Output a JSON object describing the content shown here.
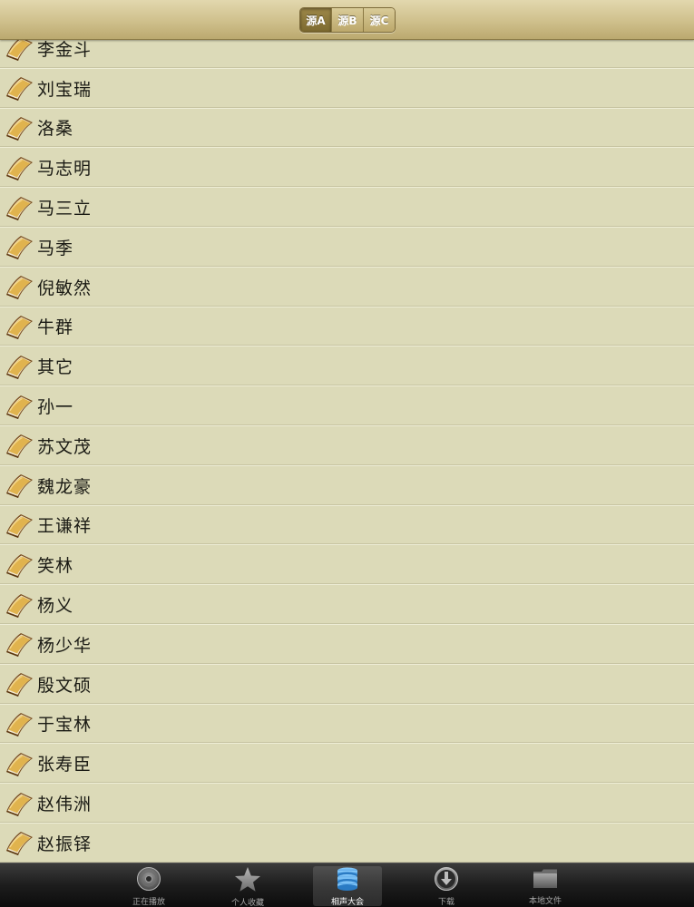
{
  "header": {
    "segments": [
      {
        "label": "源A",
        "selected": true
      },
      {
        "label": "源B",
        "selected": false
      },
      {
        "label": "源C",
        "selected": false
      }
    ]
  },
  "list": {
    "icon": "book-icon",
    "items": [
      "李金斗",
      "刘宝瑞",
      "洛桑",
      "马志明",
      "马三立",
      "马季",
      "倪敏然",
      "牛群",
      "其它",
      "孙一",
      "苏文茂",
      "魏龙豪",
      "王谦祥",
      "笑林",
      "杨义",
      "杨少华",
      "殷文硕",
      "于宝林",
      "张寿臣",
      "赵伟洲",
      "赵振铎"
    ]
  },
  "tabbar": {
    "items": [
      {
        "label": "正在播放",
        "icon": "disc-icon",
        "active": false
      },
      {
        "label": "个人收藏",
        "icon": "star-icon",
        "active": false
      },
      {
        "label": "相声大会",
        "icon": "database-icon",
        "active": true
      },
      {
        "label": "下载",
        "icon": "download-icon",
        "active": false
      },
      {
        "label": "本地文件",
        "icon": "folder-icon",
        "active": false
      }
    ]
  },
  "colors": {
    "list_background": "#dcdab8",
    "header_gold": "#cfc08c",
    "tab_active_blue": "#4aa3e6"
  }
}
